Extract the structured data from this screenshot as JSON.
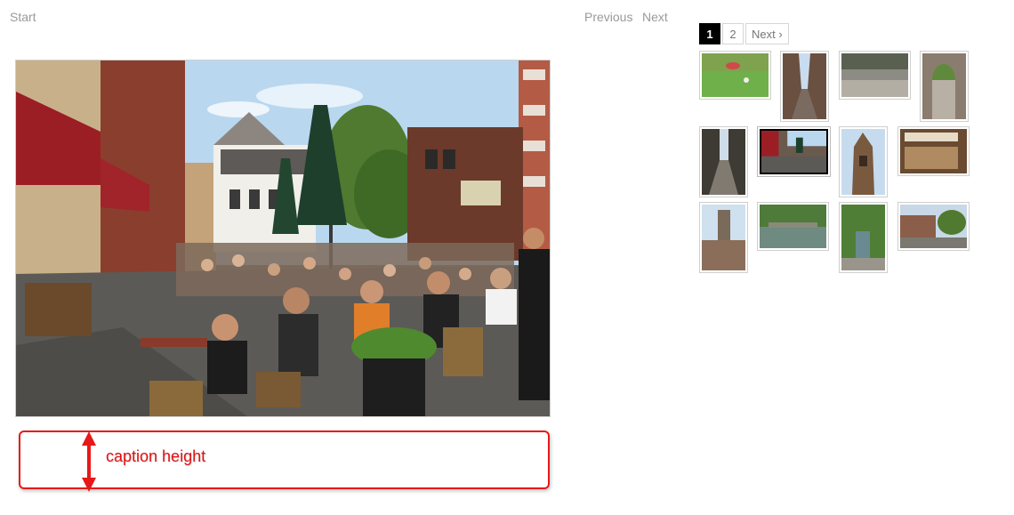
{
  "nav": {
    "start": "Start",
    "previous": "Previous",
    "next": "Next"
  },
  "pagination": {
    "current": "1",
    "page2": "2",
    "next": "Next ›"
  },
  "annotation": {
    "label": "caption height",
    "color": "#e81818"
  },
  "thumbnails": [
    {
      "subject": "park lawn"
    },
    {
      "subject": "narrow street"
    },
    {
      "subject": "plaza"
    },
    {
      "subject": "archway"
    },
    {
      "subject": "alley"
    },
    {
      "subject": "cafe terrace",
      "active": true
    },
    {
      "subject": "cathedral tower"
    },
    {
      "subject": "shop front"
    },
    {
      "subject": "church tower"
    },
    {
      "subject": "canal"
    },
    {
      "subject": "canal street"
    },
    {
      "subject": "canal houses"
    }
  ]
}
